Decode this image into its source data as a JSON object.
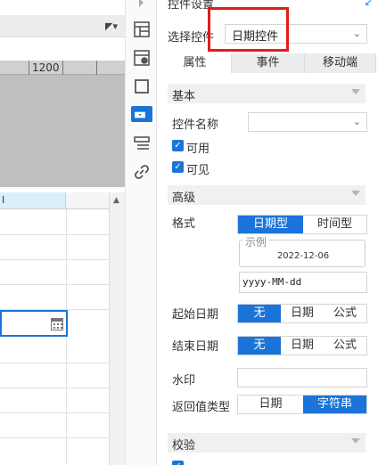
{
  "editor": {
    "ruler_value": "1200",
    "column_header": "I"
  },
  "toolbar": {
    "icons": [
      "layout-icon",
      "cell-properties-icon",
      "border-icon",
      "widget-settings-icon",
      "list-icon",
      "link-icon"
    ]
  },
  "panel": {
    "title": "控件设置",
    "select_control_label": "选择控件",
    "selected_control": "日期控件",
    "tabs": [
      "属性",
      "事件",
      "移动端"
    ],
    "sections": {
      "basic": "基本",
      "advanced": "高级",
      "validation": "校验"
    },
    "control_name_label": "控件名称",
    "control_name_value": "",
    "enabled_label": "可用",
    "visible_label": "可见",
    "format_label": "格式",
    "format_options": [
      "日期型",
      "时间型"
    ],
    "preview_caption": "示例",
    "preview_date": "2022-12-06",
    "format_pattern": "yyyy-MM-dd",
    "start_date_label": "起始日期",
    "end_date_label": "结束日期",
    "date_options": [
      "无",
      "日期",
      "公式"
    ],
    "watermark_label": "水印",
    "watermark_value": "",
    "return_type_label": "返回值类型",
    "return_type_options": [
      "日期",
      "字符串"
    ]
  },
  "colors": {
    "accent": "#1b74d9",
    "highlight_box": "#e31b1b"
  }
}
